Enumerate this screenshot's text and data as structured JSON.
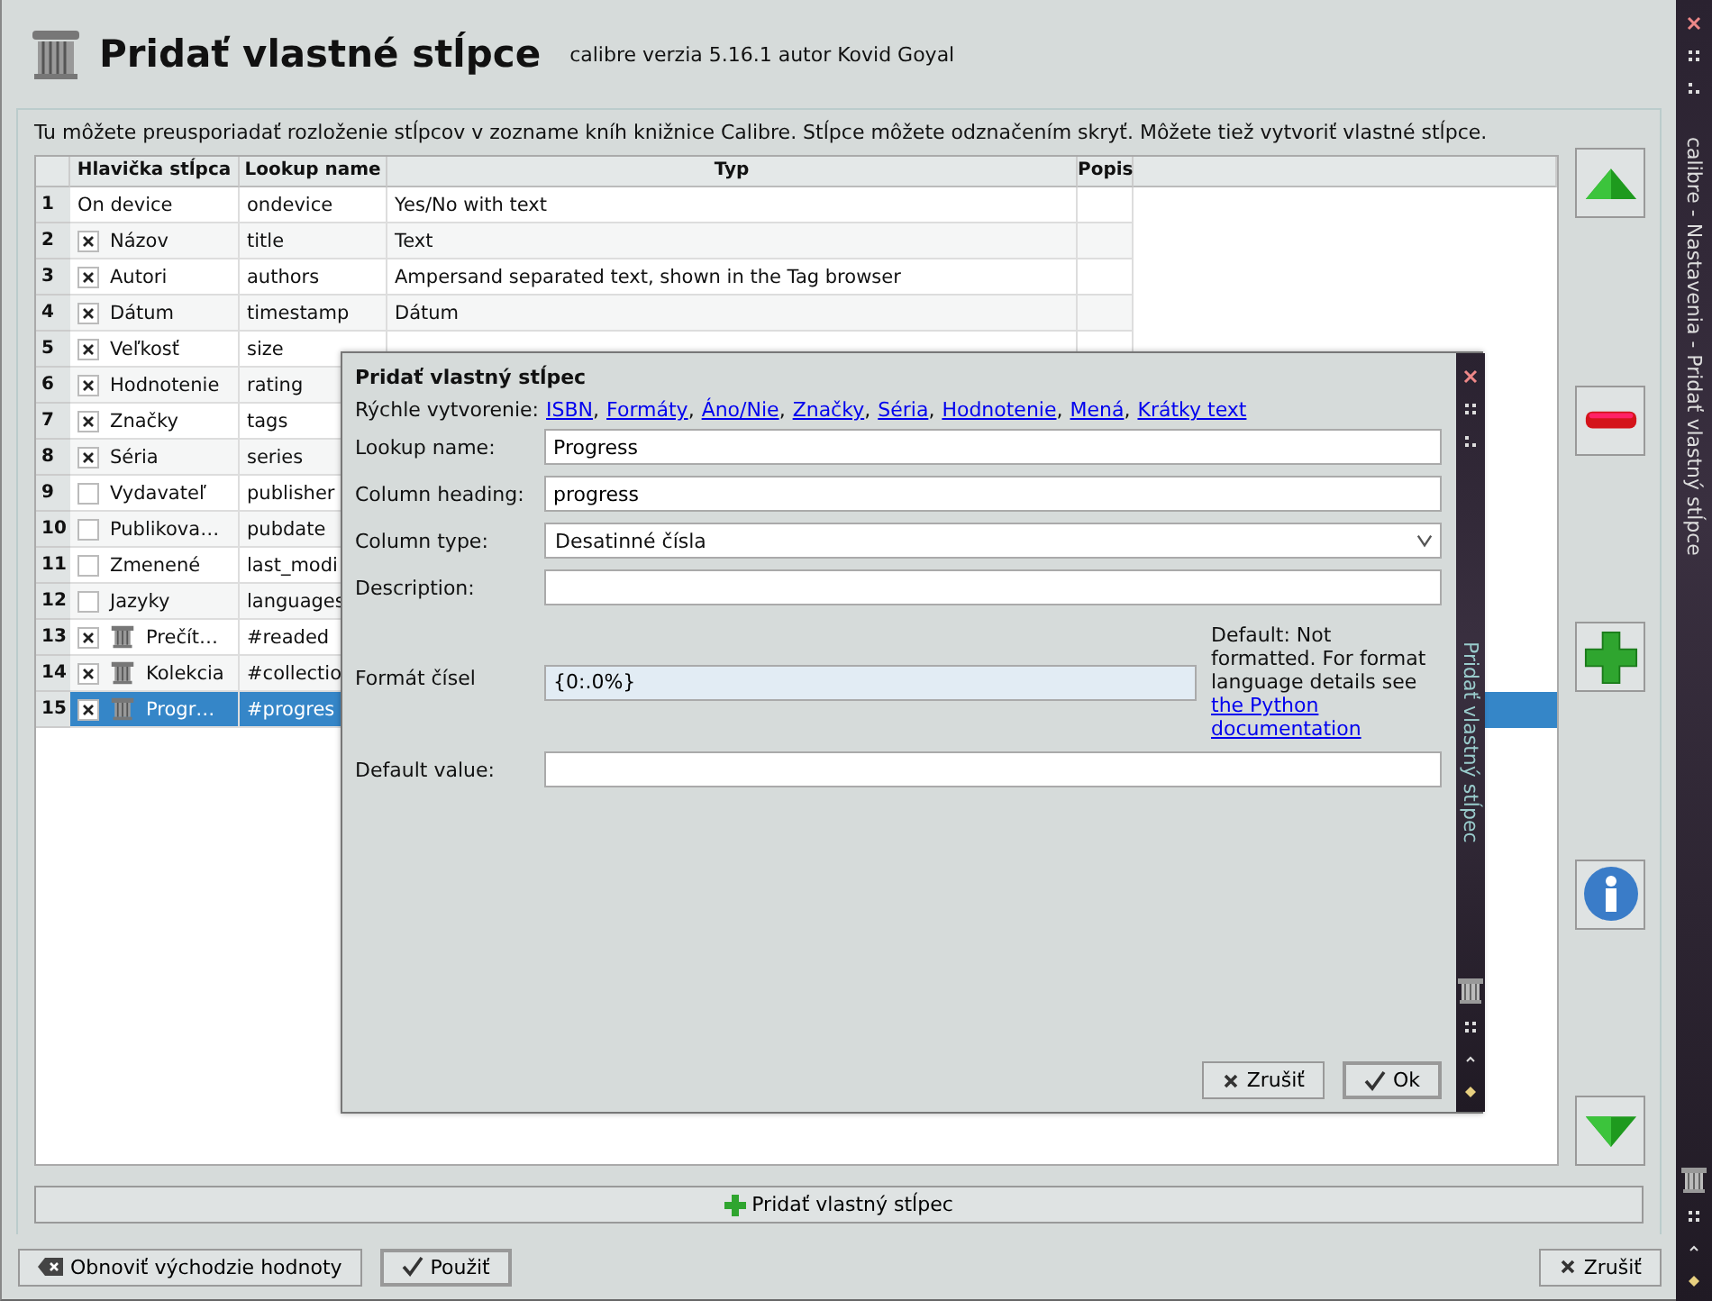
{
  "header": {
    "title": "Pridať vlastné stĺpce",
    "subtitle": "calibre verzia 5.16.1 autor Kovid Goyal"
  },
  "description": "Tu môžete preusporiadať rozloženie stĺpcov v zozname kníh knižnice Calibre. Stĺpce môžete odznačením skryť. Môžete tiež vytvoriť vlastné stĺpce.",
  "table": {
    "columns": [
      "Hlavička stĺpca",
      "Lookup name",
      "Typ",
      "Popis"
    ],
    "rows": [
      {
        "number": "1",
        "kind": "plain",
        "heading": "On device",
        "lookup": "ondevice",
        "type": "Yes/No with text",
        "selected": false
      },
      {
        "number": "2",
        "kind": "builtin",
        "checked": true,
        "heading": "Názov",
        "lookup": "title",
        "type": "Text",
        "selected": false
      },
      {
        "number": "3",
        "kind": "builtin",
        "checked": true,
        "heading": "Autori",
        "lookup": "authors",
        "type": "Ampersand separated text, shown in the Tag browser",
        "selected": false
      },
      {
        "number": "4",
        "kind": "builtin",
        "checked": true,
        "heading": "Dátum",
        "lookup": "timestamp",
        "type": "Dátum",
        "selected": false
      },
      {
        "number": "5",
        "kind": "builtin",
        "checked": true,
        "heading": "Veľkosť",
        "lookup": "size",
        "selected": false
      },
      {
        "number": "6",
        "kind": "builtin",
        "checked": true,
        "heading": "Hodnotenie",
        "lookup": "rating",
        "selected": false
      },
      {
        "number": "7",
        "kind": "builtin",
        "checked": true,
        "heading": "Značky",
        "lookup": "tags",
        "selected": false
      },
      {
        "number": "8",
        "kind": "builtin",
        "checked": true,
        "heading": "Séria",
        "lookup": "series",
        "selected": false
      },
      {
        "number": "9",
        "kind": "builtin",
        "checked": false,
        "heading": "Vydavateľ",
        "lookup": "publisher",
        "selected": false
      },
      {
        "number": "10",
        "kind": "builtin",
        "checked": false,
        "heading": "Publikova…",
        "lookup": "pubdate",
        "selected": false
      },
      {
        "number": "11",
        "kind": "builtin",
        "checked": false,
        "heading": "Zmenené",
        "lookup": "last_modi",
        "selected": false
      },
      {
        "number": "12",
        "kind": "builtin",
        "checked": false,
        "heading": "Jazyky",
        "lookup": "languages",
        "selected": false
      },
      {
        "number": "13",
        "kind": "custom",
        "checked": true,
        "heading": "Prečít…",
        "lookup": "#readed",
        "selected": false
      },
      {
        "number": "14",
        "kind": "custom",
        "checked": true,
        "heading": "Kolekcia",
        "lookup": "#collectio",
        "selected": false
      },
      {
        "number": "15",
        "kind": "custom",
        "checked": true,
        "heading": "Progr…",
        "lookup": "#progres",
        "selected": true
      }
    ]
  },
  "add_button": "Pridať vlastný stĺpec",
  "bottom_buttons": [
    {
      "label": "Obnoviť východzie hodnoty",
      "kind": "restore"
    },
    {
      "label": "Použiť",
      "kind": "apply"
    },
    {
      "label": "Zrušiť",
      "kind": "cancel"
    }
  ],
  "window_strip_title": "calibre - Nastavenia - Pridať vlastný stĺpce",
  "dialog": {
    "title": "Pridať vlastný stĺpec",
    "strip_title": "Pridať vlastný stĺpec",
    "quick_create_label": "Rýchle vytvorenie:",
    "quick_create_links": [
      {
        "label": "ISBN",
        "separator": ","
      },
      {
        "label": "Formáty",
        "separator": ","
      },
      {
        "label": "Áno/Nie",
        "separator": ","
      },
      {
        "label": "Značky",
        "separator": ","
      },
      {
        "label": "Séria",
        "separator": ","
      },
      {
        "label": "Hodnotenie",
        "separator": ","
      },
      {
        "label": "Mená",
        "separator": ","
      },
      {
        "label": "Krátky text"
      }
    ],
    "fields": [
      {
        "label": "Lookup name:",
        "kind": "text",
        "value": "Progress"
      },
      {
        "label": "Column heading:",
        "kind": "text",
        "value": "progress"
      },
      {
        "label": "Column type:",
        "kind": "select",
        "value": "Desatinné čísla"
      },
      {
        "label": "Description:",
        "kind": "text"
      },
      {
        "label": "Formát čísel",
        "kind": "format",
        "value": "{0:.0%}",
        "help": "Default: Not formatted. For format language details see",
        "help_link": "the Python documentation"
      },
      {
        "label": "Default value:",
        "kind": "text"
      }
    ],
    "buttons": [
      {
        "label": "Zrušiť",
        "kind": "cancel"
      },
      {
        "label": "Ok",
        "kind": "ok"
      }
    ]
  }
}
